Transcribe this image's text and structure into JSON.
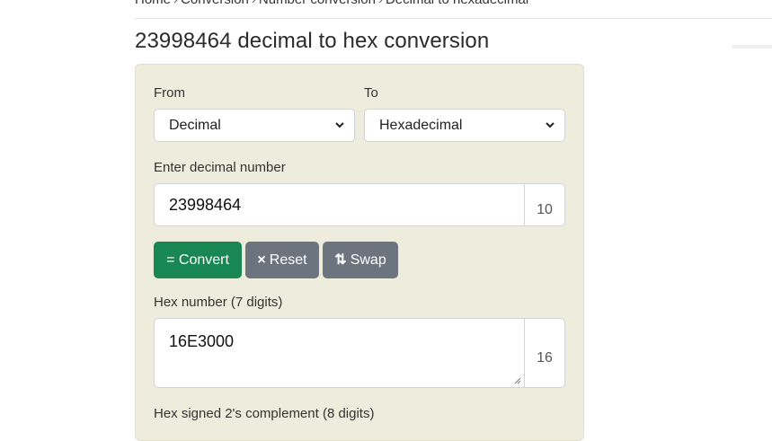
{
  "breadcrumb": [
    "Home",
    "Conversion",
    "Number conversion",
    "Decimal to hexadecimal"
  ],
  "breadcrumb_sep": "›",
  "title": "23998464 decimal to hex conversion",
  "form": {
    "from_label": "From",
    "from_value": "Decimal",
    "to_label": "To",
    "to_value": "Hexadecimal",
    "input_label": "Enter decimal number",
    "input_value": "23998464",
    "input_base": "10",
    "convert_label": "= Convert",
    "reset_icon": "×",
    "reset_label": "Reset",
    "swap_icon": "⇅",
    "swap_label": "Swap",
    "hex_label": "Hex number (7 digits)",
    "hex_value": "16E3000",
    "hex_base": "16",
    "twos_label": "Hex signed 2's complement (8 digits)"
  }
}
